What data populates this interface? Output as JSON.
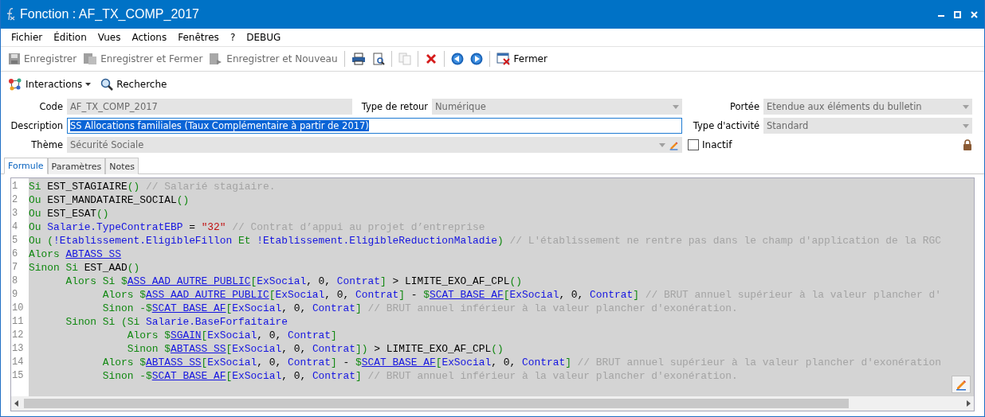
{
  "window": {
    "title": "Fonction : AF_TX_COMP_2017"
  },
  "menu": [
    "Fichier",
    "Édition",
    "Vues",
    "Actions",
    "Fenêtres",
    "?",
    "DEBUG"
  ],
  "toolbar": [
    {
      "kind": "button",
      "label": "Enregistrer",
      "disabled": true
    },
    {
      "kind": "button",
      "label": "Enregistrer et Fermer",
      "disabled": true
    },
    {
      "kind": "button",
      "label": "Enregistrer et Nouveau",
      "disabled": true
    },
    {
      "kind": "separator"
    },
    {
      "kind": "button",
      "disabled": false
    },
    {
      "kind": "button",
      "disabled": false
    },
    {
      "kind": "separator"
    },
    {
      "kind": "button",
      "disabled": true
    },
    {
      "kind": "separator"
    },
    {
      "kind": "button",
      "disabled": false
    },
    {
      "kind": "separator"
    },
    {
      "kind": "button",
      "disabled": false
    },
    {
      "kind": "button",
      "disabled": false
    },
    {
      "kind": "separator"
    },
    {
      "kind": "button",
      "label": "Fermer",
      "disabled": false
    }
  ],
  "toolbar2": [
    {
      "label": "Interactions",
      "dropdown": true
    },
    {
      "label": "Recherche",
      "dropdown": false
    }
  ],
  "form": {
    "code": {
      "label": "Code",
      "value": "AF_TX_COMP_2017"
    },
    "return_type": {
      "label": "Type de retour",
      "value": "Numérique"
    },
    "scope": {
      "label": "Portée",
      "value": "Etendue aux éléments du bulletin"
    },
    "description": {
      "label": "Description",
      "value": "SS Allocations familiales (Taux Complémentaire à partir de 2017)"
    },
    "activity_type": {
      "label": "Type d'activité",
      "value": "Standard"
    },
    "theme": {
      "label": "Thème",
      "value": "Sécurité Sociale"
    },
    "inactive": {
      "label": "Inactif",
      "checked": false
    }
  },
  "tabs": [
    {
      "label": "Formule",
      "selected": true
    },
    {
      "label": "Paramètres",
      "selected": false
    },
    {
      "label": "Notes",
      "selected": false
    }
  ],
  "code_lines": [
    {
      "number": "1",
      "tokens": [
        {
          "kind": "kw",
          "text": "Si"
        },
        {
          "kind": "plain",
          "text": " EST_STAGIAIRE"
        },
        {
          "kind": "kw",
          "text": "()"
        },
        {
          "kind": "comment",
          "text": " // Salarié stagiaire."
        }
      ]
    },
    {
      "number": "2",
      "tokens": [
        {
          "kind": "kw",
          "text": "Ou"
        },
        {
          "kind": "plain",
          "text": " EST_MANDATAIRE_SOCIAL"
        },
        {
          "kind": "kw",
          "text": "()"
        }
      ]
    },
    {
      "number": "3",
      "tokens": [
        {
          "kind": "kw",
          "text": "Ou"
        },
        {
          "kind": "plain",
          "text": " EST_ESAT"
        },
        {
          "kind": "kw",
          "text": "()"
        }
      ]
    },
    {
      "number": "4",
      "tokens": [
        {
          "kind": "kw",
          "text": "Ou"
        },
        {
          "kind": "ref",
          "text": " Salarie.TypeContratEBP"
        },
        {
          "kind": "plain",
          "text": " = "
        },
        {
          "kind": "str",
          "text": "\"32\""
        },
        {
          "kind": "comment",
          "text": " // Contrat d’appui au projet d’entreprise"
        }
      ]
    },
    {
      "number": "5",
      "tokens": [
        {
          "kind": "kw",
          "text": "Ou ("
        },
        {
          "kind": "ref",
          "text": "!Etablissement.EligibleFillon"
        },
        {
          "kind": "kw",
          "text": " Et "
        },
        {
          "kind": "ref",
          "text": "!Etablissement.EligibleReductionMaladie"
        },
        {
          "kind": "kw",
          "text": ")"
        },
        {
          "kind": "comment",
          "text": " // L'établissement ne rentre pas dans le champ d'application de la RGC"
        }
      ]
    },
    {
      "number": "6",
      "tokens": [
        {
          "kind": "kw",
          "text": "Alors "
        },
        {
          "kind": "link",
          "text": "ABTASS_SS"
        }
      ]
    },
    {
      "number": "7",
      "tokens": [
        {
          "kind": "kw",
          "text": "Sinon Si "
        },
        {
          "kind": "plain",
          "text": "EST_AAD"
        },
        {
          "kind": "kw",
          "text": "()"
        }
      ]
    },
    {
      "number": "8",
      "tokens": [
        {
          "kind": "kw",
          "text": "      Alors Si $"
        },
        {
          "kind": "link",
          "text": "ASS_AAD_AUTRE_PUBLIC"
        },
        {
          "kind": "kw",
          "text": "["
        },
        {
          "kind": "ref",
          "text": "ExSocial"
        },
        {
          "kind": "plain",
          "text": ", 0, "
        },
        {
          "kind": "ref",
          "text": "Contrat"
        },
        {
          "kind": "kw",
          "text": "]"
        },
        {
          "kind": "plain",
          "text": " > LIMITE_EXO_AF_CPL"
        },
        {
          "kind": "kw",
          "text": "()"
        }
      ]
    },
    {
      "number": "9",
      "tokens": [
        {
          "kind": "kw",
          "text": "            Alors $"
        },
        {
          "kind": "link",
          "text": "ASS_AAD_AUTRE_PUBLIC"
        },
        {
          "kind": "kw",
          "text": "["
        },
        {
          "kind": "ref",
          "text": "ExSocial"
        },
        {
          "kind": "plain",
          "text": ", 0, "
        },
        {
          "kind": "ref",
          "text": "Contrat"
        },
        {
          "kind": "kw",
          "text": "]"
        },
        {
          "kind": "plain",
          "text": " - "
        },
        {
          "kind": "kw",
          "text": "$"
        },
        {
          "kind": "link",
          "text": "SCAT_BASE_AF"
        },
        {
          "kind": "kw",
          "text": "["
        },
        {
          "kind": "ref",
          "text": "ExSocial"
        },
        {
          "kind": "plain",
          "text": ", 0, "
        },
        {
          "kind": "ref",
          "text": "Contrat"
        },
        {
          "kind": "kw",
          "text": "]"
        },
        {
          "kind": "comment",
          "text": " // BRUT annuel supérieur à la valeur plancher d'"
        }
      ]
    },
    {
      "number": "10",
      "tokens": [
        {
          "kind": "kw",
          "text": "            Sinon -$"
        },
        {
          "kind": "link",
          "text": "SCAT_BASE_AF"
        },
        {
          "kind": "kw",
          "text": "["
        },
        {
          "kind": "ref",
          "text": "ExSocial"
        },
        {
          "kind": "plain",
          "text": ", 0, "
        },
        {
          "kind": "ref",
          "text": "Contrat"
        },
        {
          "kind": "kw",
          "text": "]"
        },
        {
          "kind": "comment",
          "text": " // BRUT annuel inférieur à la valeur plancher d'exonération."
        }
      ]
    },
    {
      "number": "11",
      "tokens": [
        {
          "kind": "kw",
          "text": "      Sinon Si (Si "
        },
        {
          "kind": "ref",
          "text": "Salarie.BaseForfaitaire"
        }
      ]
    },
    {
      "number": "12",
      "tokens": [
        {
          "kind": "kw",
          "text": "                Alors $"
        },
        {
          "kind": "link",
          "text": "SGAIN"
        },
        {
          "kind": "kw",
          "text": "["
        },
        {
          "kind": "ref",
          "text": "ExSocial"
        },
        {
          "kind": "plain",
          "text": ", 0, "
        },
        {
          "kind": "ref",
          "text": "Contrat"
        },
        {
          "kind": "kw",
          "text": "]"
        }
      ]
    },
    {
      "number": "13",
      "tokens": [
        {
          "kind": "kw",
          "text": "                Sinon $"
        },
        {
          "kind": "link",
          "text": "ABTASS_SS"
        },
        {
          "kind": "kw",
          "text": "["
        },
        {
          "kind": "ref",
          "text": "ExSocial"
        },
        {
          "kind": "plain",
          "text": ", 0, "
        },
        {
          "kind": "ref",
          "text": "Contrat"
        },
        {
          "kind": "kw",
          "text": "])"
        },
        {
          "kind": "plain",
          "text": " > LIMITE_EXO_AF_CPL"
        },
        {
          "kind": "kw",
          "text": "()"
        }
      ]
    },
    {
      "number": "14",
      "tokens": [
        {
          "kind": "kw",
          "text": "            Alors $"
        },
        {
          "kind": "link",
          "text": "ABTASS_SS"
        },
        {
          "kind": "kw",
          "text": "["
        },
        {
          "kind": "ref",
          "text": "ExSocial"
        },
        {
          "kind": "plain",
          "text": ", 0, "
        },
        {
          "kind": "ref",
          "text": "Contrat"
        },
        {
          "kind": "kw",
          "text": "]"
        },
        {
          "kind": "plain",
          "text": " - "
        },
        {
          "kind": "kw",
          "text": "$"
        },
        {
          "kind": "link",
          "text": "SCAT_BASE_AF"
        },
        {
          "kind": "kw",
          "text": "["
        },
        {
          "kind": "ref",
          "text": "ExSocial"
        },
        {
          "kind": "plain",
          "text": ", 0, "
        },
        {
          "kind": "ref",
          "text": "Contrat"
        },
        {
          "kind": "kw",
          "text": "]"
        },
        {
          "kind": "comment",
          "text": " // BRUT annuel supérieur à la valeur plancher d'exonération"
        }
      ]
    },
    {
      "number": "15",
      "tokens": [
        {
          "kind": "kw",
          "text": "            Sinon -$"
        },
        {
          "kind": "link",
          "text": "SCAT_BASE_AF"
        },
        {
          "kind": "kw",
          "text": "["
        },
        {
          "kind": "ref",
          "text": "ExSocial"
        },
        {
          "kind": "plain",
          "text": ", 0, "
        },
        {
          "kind": "ref",
          "text": "Contrat"
        },
        {
          "kind": "kw",
          "text": "]"
        },
        {
          "kind": "comment",
          "text": " // BRUT annuel inférieur à la valeur plancher d'exonération."
        }
      ]
    }
  ]
}
